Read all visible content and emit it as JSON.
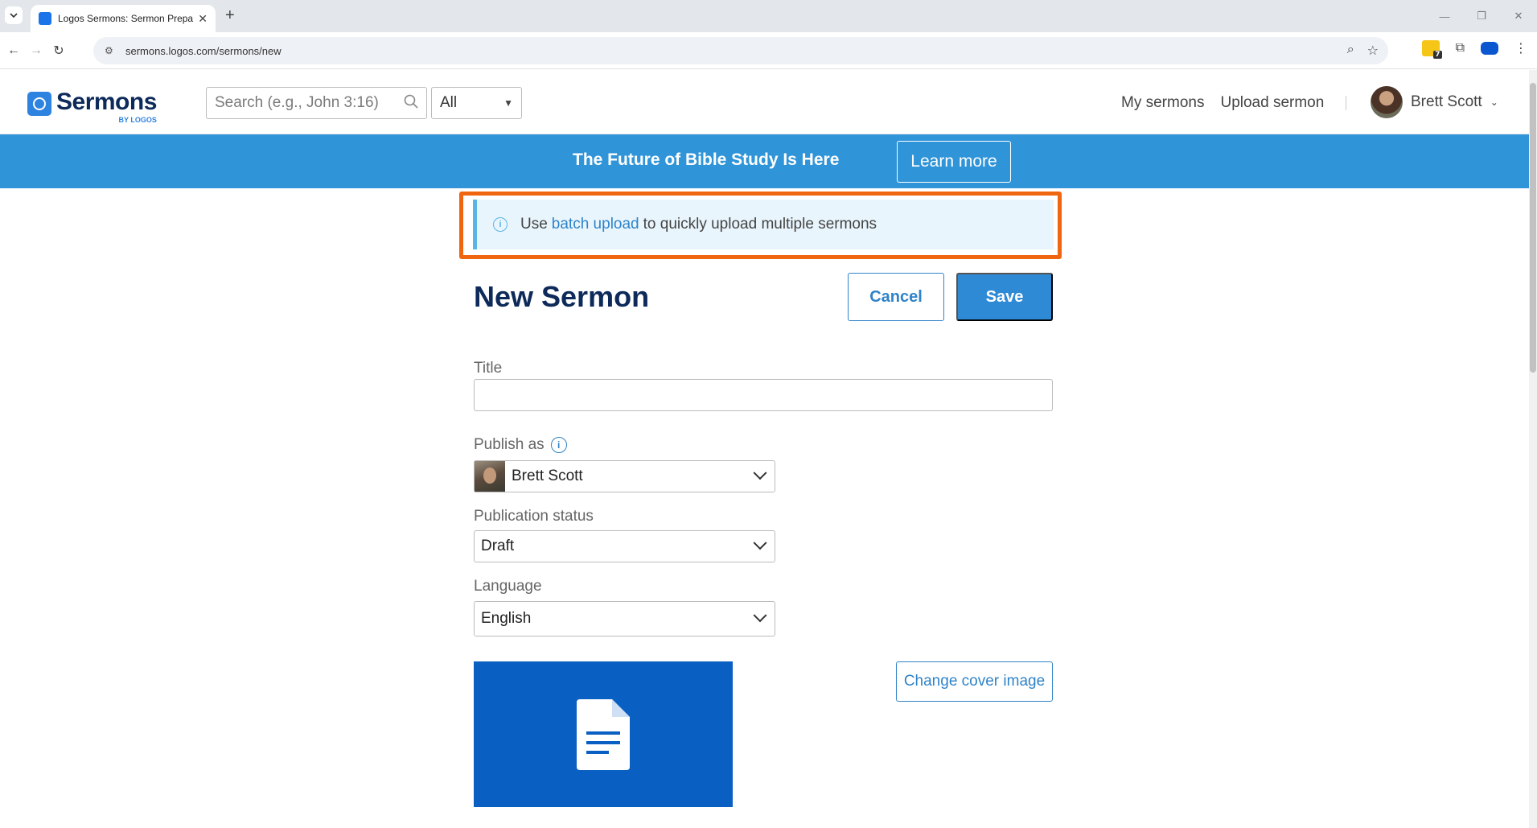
{
  "browser": {
    "tab_title": "Logos Sermons: Sermon Prepar",
    "tab_close": "✕",
    "new_tab": "+",
    "url": "sermons.logos.com/sermons/new",
    "extension_badge": "7"
  },
  "site": {
    "logo_text": "Sermons",
    "logo_sub": "BY LOGOS",
    "search_placeholder": "Search (e.g., John 3:16)",
    "scope_value": "All",
    "nav": [
      "My sermons",
      "Upload sermon"
    ],
    "user_name": "Brett Scott"
  },
  "promo": {
    "text": "The Future of Bible Study Is Here",
    "button": "Learn more"
  },
  "alert": {
    "prefix": "Use",
    "link": "batch upload",
    "suffix": "to quickly upload multiple sermons"
  },
  "form": {
    "title": "New Sermon",
    "cancel": "Cancel",
    "save": "Save",
    "title_label": "Title",
    "title_value": "",
    "publish_label": "Publish as",
    "publish_value": "Brett Scott",
    "status_label": "Publication status",
    "status_value": "Draft",
    "language_label": "Language",
    "language_value": "English",
    "change_cover": "Change cover image"
  },
  "colors": {
    "brand_navy": "#0d2a5a",
    "primary_blue": "#2f8ad6",
    "banner_blue": "#2f94d8",
    "highlight_orange": "#f0650f",
    "cover_blue": "#0a5fc2"
  }
}
